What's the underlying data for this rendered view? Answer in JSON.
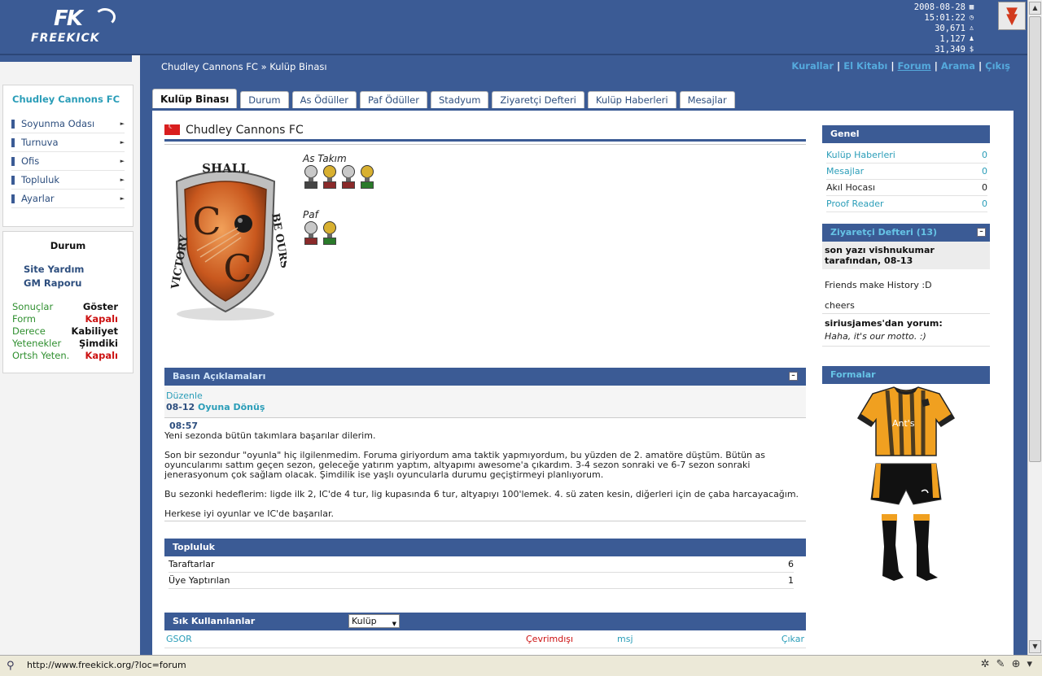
{
  "header": {
    "logo_top": "FK",
    "logo_word": "FREEKICK",
    "stats": [
      {
        "value": "2008-08-28",
        "icon": "calendar-icon",
        "glyph": "▦"
      },
      {
        "value": "15:01:22",
        "icon": "clock-icon",
        "glyph": "◷"
      },
      {
        "value": "30,671",
        "icon": "users-icon",
        "glyph": "♙"
      },
      {
        "value": "1,127",
        "icon": "online-user-icon",
        "glyph": "♟"
      },
      {
        "value": "31,349",
        "icon": "dollar-icon",
        "glyph": "$"
      }
    ]
  },
  "breadcrumb": "Chudley Cannons FC » Kulüp Binası",
  "toplinks": [
    "Kurallar",
    "El Kitabı",
    "Forum",
    "Arama",
    "Çıkış"
  ],
  "left": {
    "club_name": "Chudley Cannons FC",
    "menu": [
      "Soyunma Odası",
      "Turnuva",
      "Ofis",
      "Topluluk",
      "Ayarlar"
    ],
    "status_title": "Durum",
    "links": [
      "Site Yardım",
      "GM Raporu"
    ],
    "status_rows": [
      {
        "k": "Sonuçlar",
        "v": "Göster"
      },
      {
        "k": "Form",
        "v": "Kapalı"
      },
      {
        "k": "Derece",
        "v": "Kabiliyet"
      },
      {
        "k": "Yetenekler",
        "v": "Şimdiki"
      },
      {
        "k": "Ortsh Yeten.",
        "v": "Kapalı"
      }
    ]
  },
  "tabs": [
    "Kulüp Binası",
    "Durum",
    "As Ödüller",
    "Paf Ödüller",
    "Stadyum",
    "Ziyaretçi Defteri",
    "Kulüp Haberleri",
    "Mesajlar"
  ],
  "club": {
    "name": "Chudley Cannons FC",
    "crest_text_top": "SHALL",
    "crest_text_left": "VICTORY",
    "crest_text_right": "BE OURS",
    "trophy_label_a": "As Takım",
    "trophy_label_b": "Paf"
  },
  "press": {
    "title": "Basın Açıklamaları",
    "edit": "Düzenle",
    "date": "08-12",
    "date_title": "Oyuna Dönüş",
    "time": "08:57",
    "paragraphs": [
      "Yeni sezonda bütün takımlara başarılar dilerim.",
      "Son bir sezondur \"oyunla\" hiç ilgilenmedim. Foruma giriyordum ama taktik yapmıyordum, bu yüzden de 2. amatöre düştüm. Bütün as oyuncularımı sattım geçen sezon, geleceğe yatırım yaptım, altyapımı awesome'a çıkardım. 3-4 sezon sonraki ve 6-7 sezon sonraki jenerasyonum çok sağlam olacak. Şimdilik ise yaşlı oyuncularla durumu geçiştirmeyi planlıyorum.",
      "Bu sezonki hedeflerim: ligde ilk 2, IC'de 4 tur, lig kupasında 6 tur, altyapıyı 100'lemek. 4. sü zaten kesin, diğerleri için de çaba harcayacağım.",
      "Herkese iyi oyunlar ve IC'de başarılar."
    ]
  },
  "community": {
    "title": "Topluluk",
    "rows": [
      {
        "k": "Taraftarlar",
        "v": "6"
      },
      {
        "k": "Üye Yaptırılan",
        "v": "1"
      }
    ]
  },
  "frequent": {
    "title": "Sık Kullanılanlar",
    "select": "Kulüp",
    "cols": [
      "GSOR",
      "Çevrimdışı",
      "msj",
      "Çıkar"
    ]
  },
  "genel": {
    "title": "Genel",
    "rows": [
      {
        "k": "Kulüp Haberleri",
        "v": "0"
      },
      {
        "k": "Mesajlar",
        "v": "0"
      },
      {
        "k": "Akıl Hocası",
        "v": "0"
      },
      {
        "k": "Proof Reader",
        "v": "0"
      }
    ]
  },
  "guestbook": {
    "title": "Ziyaretçi Defteri (13)",
    "last": "son yazı vishnukumar tarafından, 08-13",
    "msg1": "Friends make History :D",
    "msg2": "cheers",
    "comment_by": "siriusjames'dan yorum:",
    "comment": "Haha, it's our motto. :)"
  },
  "kits": {
    "title": "Formalar",
    "shirt_text": "Ant's"
  },
  "statusbar": {
    "url": "http://www.freekick.org/?loc=forum"
  },
  "colors": {
    "header": "#3b5b95",
    "link": "#2a9db8",
    "red": "#cc1111",
    "green": "#2f8f2f"
  }
}
